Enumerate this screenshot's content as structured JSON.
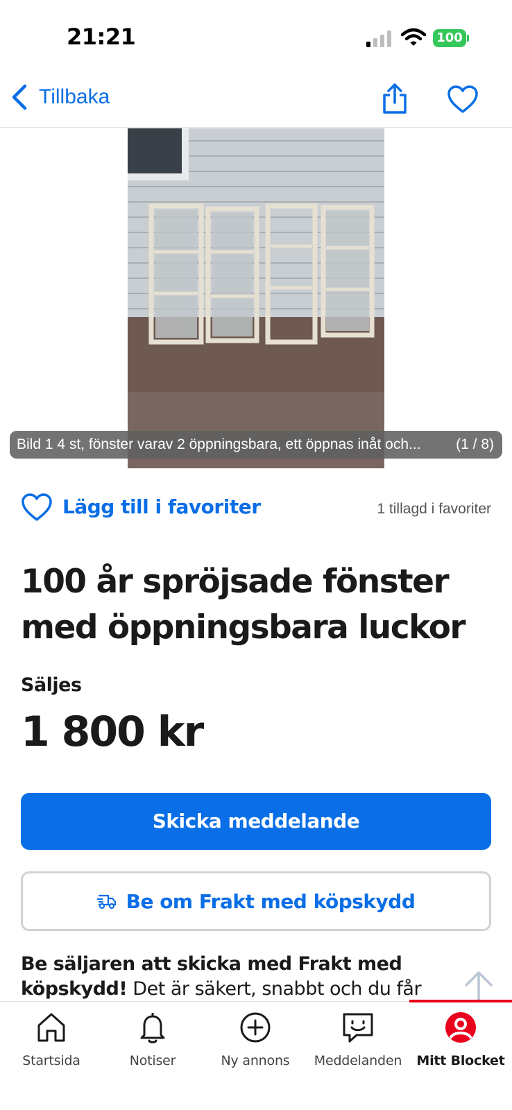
{
  "status_bar": {
    "time": "21:21",
    "battery": "100",
    "signal_icon": "cellular-signal-icon",
    "wifi_icon": "wifi-icon"
  },
  "nav": {
    "back_label": "Tillbaka",
    "share_icon": "share-icon",
    "favorite_icon": "heart-icon"
  },
  "gallery": {
    "caption": "Bild 1  4 st, fönster varav 2 öppningsbara, ett öppnas inåt och...",
    "counter": "(1 / 8)"
  },
  "favorites": {
    "add_label": "Lägg till i favoriter",
    "count_text": "1 tillagd i favoriter"
  },
  "listing": {
    "title": "100 år spröjsade fönster med öppningsbara luckor",
    "type": "Säljes",
    "price": "1 800 kr"
  },
  "actions": {
    "message_label": "Skicka meddelande",
    "shipping_label": "Be om Frakt med köpskydd"
  },
  "promo": {
    "bold": "Be säljaren att skicka med Frakt med köpskydd!",
    "text": " Det är säkert, snabbt och du får"
  },
  "tab_bar": {
    "tabs": [
      {
        "label": "Startsida",
        "icon": "home-icon"
      },
      {
        "label": "Notiser",
        "icon": "bell-icon"
      },
      {
        "label": "Ny annons",
        "icon": "plus-circle-icon"
      },
      {
        "label": "Meddelanden",
        "icon": "message-icon"
      },
      {
        "label": "Mitt Blocket",
        "icon": "profile-icon",
        "active": true
      }
    ]
  },
  "colors": {
    "accent_blue": "#0a6ee6",
    "active_red": "#e8001c",
    "battery_green": "#34c759"
  }
}
